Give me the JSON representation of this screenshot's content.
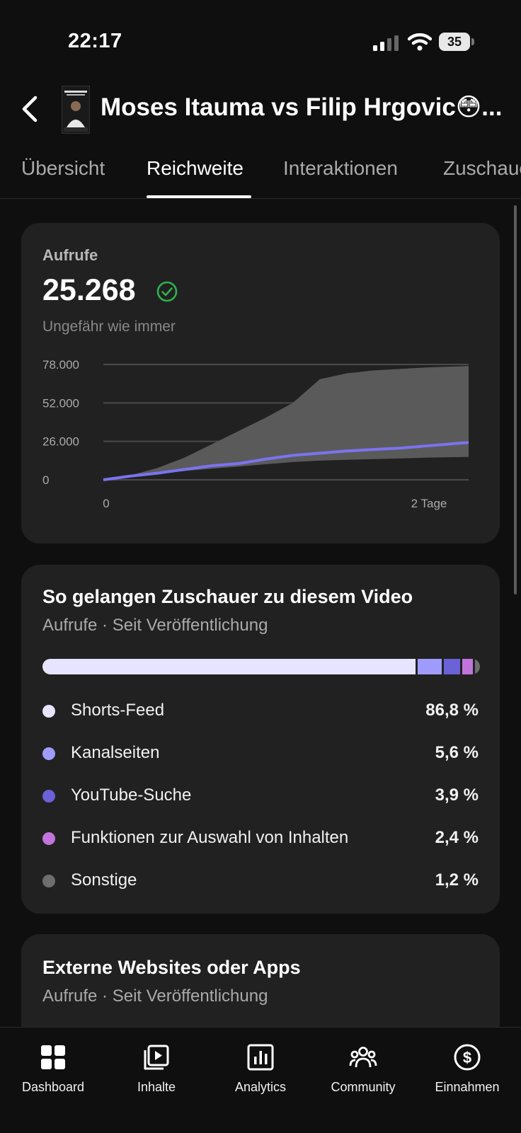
{
  "status_bar": {
    "time": "22:17",
    "battery": "35"
  },
  "header": {
    "title": "Moses Itauma vs Filip Hrgovic😳..."
  },
  "tabs": [
    {
      "label": "Übersicht"
    },
    {
      "label": "Reichweite"
    },
    {
      "label": "Interaktionen"
    },
    {
      "label": "Zuschauer"
    }
  ],
  "views_card": {
    "label": "Aufrufe",
    "value": "25.268",
    "note": "Ungefähr wie immer"
  },
  "chart_data": {
    "type": "area",
    "y_ticks": [
      "78.000",
      "52.000",
      "26.000",
      "0"
    ],
    "x_ticks": [
      "0",
      "2 Tage"
    ],
    "ylim": [
      0,
      78000
    ],
    "series": [
      {
        "role": "typical_range_upper",
        "x": [
          0,
          4,
          8,
          12,
          16,
          20,
          24,
          28,
          32,
          36,
          40,
          44,
          48,
          54
        ],
        "y": [
          0,
          3000,
          8000,
          15000,
          24000,
          33000,
          42000,
          52000,
          68000,
          72000,
          74000,
          75000,
          76000,
          77000
        ]
      },
      {
        "role": "typical_range_lower",
        "x": [
          0,
          4,
          8,
          12,
          16,
          20,
          24,
          28,
          32,
          36,
          40,
          44,
          48,
          54
        ],
        "y": [
          0,
          2000,
          4000,
          6000,
          7500,
          9000,
          10500,
          12000,
          13000,
          13500,
          14000,
          14500,
          15000,
          15500
        ]
      },
      {
        "role": "this_video",
        "color": "#7b73f0",
        "x": [
          0,
          4,
          8,
          12,
          16,
          20,
          24,
          28,
          32,
          36,
          40,
          44,
          48,
          54
        ],
        "y": [
          0,
          2500,
          4500,
          7000,
          9500,
          11000,
          14000,
          16500,
          18000,
          19500,
          20500,
          21500,
          23000,
          25268
        ]
      }
    ]
  },
  "traffic_card": {
    "title": "So gelangen Zuschauer zu diesem Video",
    "subtitle": "Aufrufe · Seit Veröffentlichung",
    "sources": [
      {
        "label": "Shorts-Feed",
        "value": "86,8 %",
        "pct": 86.8,
        "color": "#e6e4ff"
      },
      {
        "label": "Kanalseiten",
        "value": "5,6 %",
        "pct": 5.6,
        "color": "#a09cff"
      },
      {
        "label": "YouTube-Suche",
        "value": "3,9 %",
        "pct": 3.9,
        "color": "#6a62d6"
      },
      {
        "label": "Funktionen zur Auswahl von Inhalten",
        "value": "2,4 %",
        "pct": 2.4,
        "color": "#c274dc"
      },
      {
        "label": "Sonstige",
        "value": "1,2 %",
        "pct": 1.2,
        "color": "#6e6e6e"
      }
    ]
  },
  "external_card": {
    "title": "Externe Websites oder Apps",
    "subtitle": "Aufrufe · Seit Veröffentlichung"
  },
  "bottom_nav": [
    {
      "label": "Dashboard",
      "icon": "dashboard-icon"
    },
    {
      "label": "Inhalte",
      "icon": "content-icon"
    },
    {
      "label": "Analytics",
      "icon": "analytics-icon"
    },
    {
      "label": "Community",
      "icon": "community-icon"
    },
    {
      "label": "Einnahmen",
      "icon": "earnings-icon"
    }
  ]
}
